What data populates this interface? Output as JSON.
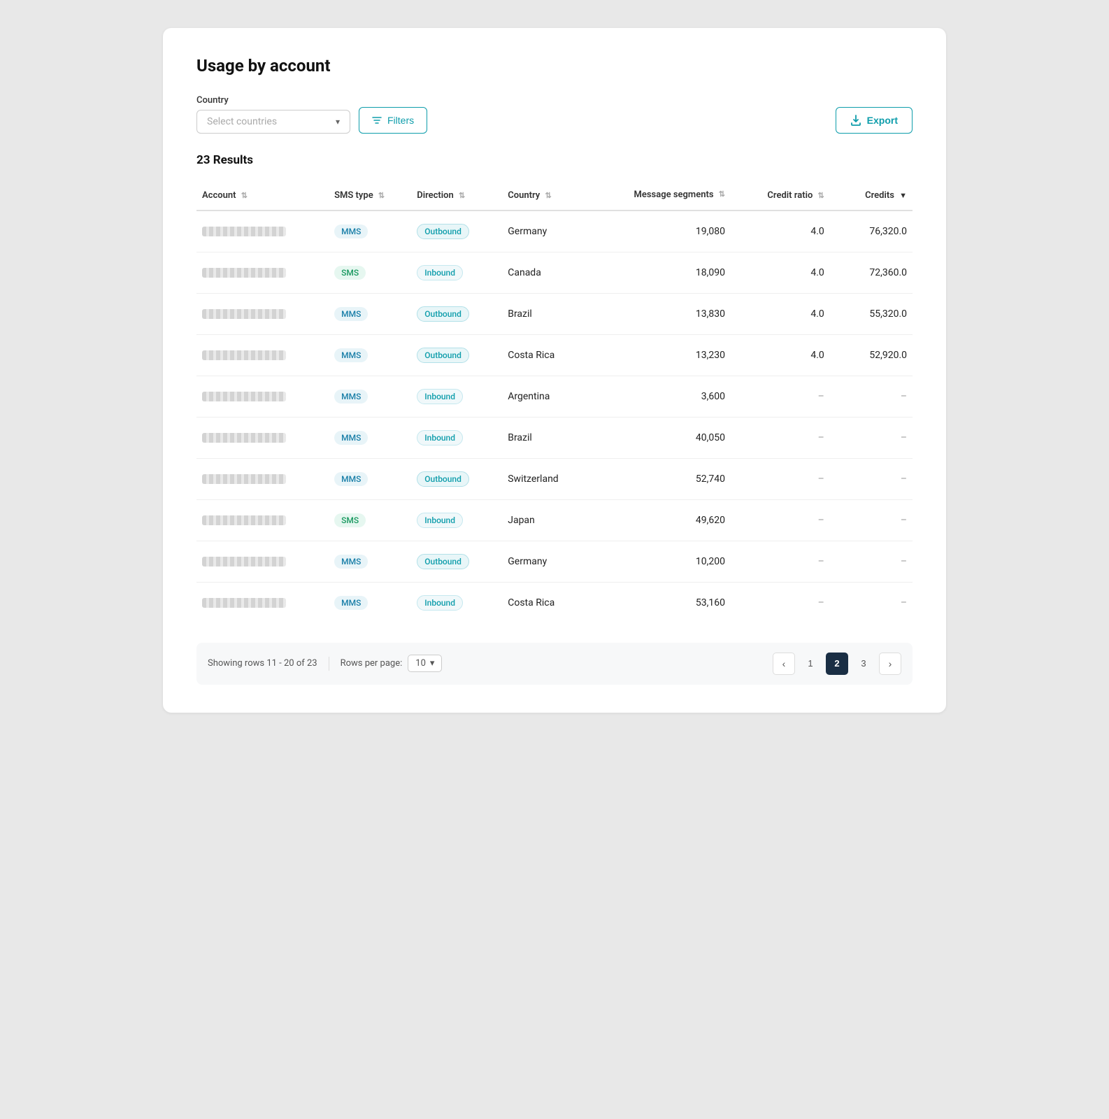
{
  "page": {
    "title": "Usage by account",
    "results_count": "23 Results"
  },
  "filters": {
    "country_label": "Country",
    "country_placeholder": "Select countries",
    "filters_button": "Filters",
    "export_button": "Export"
  },
  "table": {
    "columns": [
      {
        "key": "account",
        "label": "Account",
        "sortable": true
      },
      {
        "key": "sms_type",
        "label": "SMS type",
        "sortable": true
      },
      {
        "key": "direction",
        "label": "Direction",
        "sortable": true
      },
      {
        "key": "country",
        "label": "Country",
        "sortable": true
      },
      {
        "key": "message_segments",
        "label": "Message segments",
        "sortable": true
      },
      {
        "key": "credit_ratio",
        "label": "Credit ratio",
        "sortable": true
      },
      {
        "key": "credits",
        "label": "Credits",
        "sortable": true,
        "sorted": true
      }
    ],
    "rows": [
      {
        "account": "redacted",
        "sms_type": "MMS",
        "direction": "Outbound",
        "country": "Germany",
        "message_segments": "19,080",
        "credit_ratio": "4.0",
        "credits": "76,320.0"
      },
      {
        "account": "redacted",
        "sms_type": "SMS",
        "direction": "Inbound",
        "country": "Canada",
        "message_segments": "18,090",
        "credit_ratio": "4.0",
        "credits": "72,360.0"
      },
      {
        "account": "redacted",
        "sms_type": "MMS",
        "direction": "Outbound",
        "country": "Brazil",
        "message_segments": "13,830",
        "credit_ratio": "4.0",
        "credits": "55,320.0"
      },
      {
        "account": "redacted",
        "sms_type": "MMS",
        "direction": "Outbound",
        "country": "Costa Rica",
        "message_segments": "13,230",
        "credit_ratio": "4.0",
        "credits": "52,920.0"
      },
      {
        "account": "redacted",
        "sms_type": "MMS",
        "direction": "Inbound",
        "country": "Argentina",
        "message_segments": "3,600",
        "credit_ratio": "–",
        "credits": "–"
      },
      {
        "account": "redacted",
        "sms_type": "MMS",
        "direction": "Inbound",
        "country": "Brazil",
        "message_segments": "40,050",
        "credit_ratio": "–",
        "credits": "–"
      },
      {
        "account": "redacted",
        "sms_type": "MMS",
        "direction": "Outbound",
        "country": "Switzerland",
        "message_segments": "52,740",
        "credit_ratio": "–",
        "credits": "–"
      },
      {
        "account": "redacted",
        "sms_type": "SMS",
        "direction": "Inbound",
        "country": "Japan",
        "message_segments": "49,620",
        "credit_ratio": "–",
        "credits": "–"
      },
      {
        "account": "redacted",
        "sms_type": "MMS",
        "direction": "Outbound",
        "country": "Germany",
        "message_segments": "10,200",
        "credit_ratio": "–",
        "credits": "–"
      },
      {
        "account": "redacted",
        "sms_type": "MMS",
        "direction": "Inbound",
        "country": "Costa Rica",
        "message_segments": "53,160",
        "credit_ratio": "–",
        "credits": "–"
      }
    ]
  },
  "pagination": {
    "showing_text": "Showing rows 11 - 20 of 23",
    "rows_per_page_label": "Rows per page:",
    "rows_per_page_value": "10",
    "current_page": 2,
    "pages": [
      1,
      2,
      3
    ]
  }
}
